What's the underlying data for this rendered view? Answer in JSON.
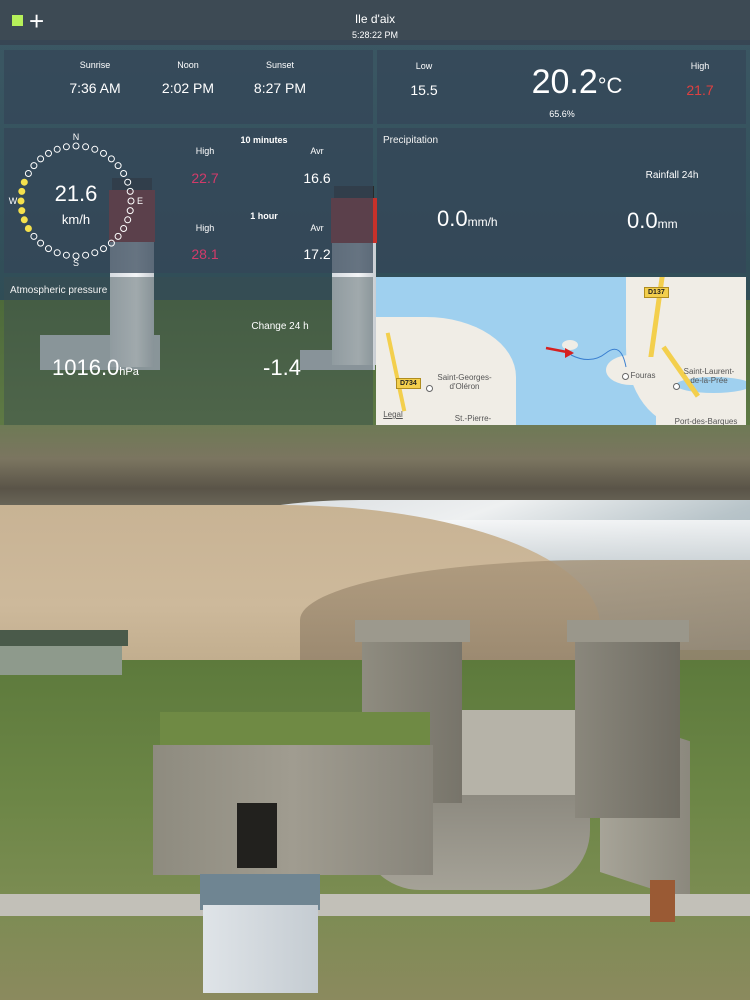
{
  "header": {
    "title": "Ile d'aix",
    "time": "5:28:22 PM",
    "add_symbol": "+",
    "status_color": "#b6f05a"
  },
  "sun": {
    "sunrise_label": "Sunrise",
    "sunrise": "7:36 AM",
    "noon_label": "Noon",
    "noon": "2:02 PM",
    "sunset_label": "Sunset",
    "sunset": "8:27 PM"
  },
  "temperature": {
    "low_label": "Low",
    "low": "15.5",
    "current": "20.2",
    "unit": "°C",
    "humidity": "65.6%",
    "high_label": "High",
    "high": "21.7"
  },
  "wind": {
    "speed": "21.6",
    "unit": "km/h",
    "compass": {
      "n": "N",
      "e": "E",
      "s": "S",
      "w": "W"
    },
    "ten_min": {
      "title": "10 minutes",
      "high_label": "High",
      "high": "22.7",
      "avg_label": "Avr",
      "avg": "16.6"
    },
    "one_hour": {
      "title": "1 hour",
      "high_label": "High",
      "high": "28.1",
      "avg_label": "Avr",
      "avg": "17.2"
    }
  },
  "precipitation": {
    "label": "Precipitation",
    "rate": "0.0",
    "rate_unit": "mm/h",
    "rainfall_label": "Rainfall 24h",
    "rainfall": "0.0",
    "rainfall_unit": "mm"
  },
  "pressure": {
    "label": "Atmospheric pressure",
    "value": "1016.0",
    "unit": "hPa",
    "change_label": "Change 24 h",
    "change": "-1.4"
  },
  "map": {
    "road_d137": "D137",
    "road_d734": "D734",
    "place_saint_georges": "Saint-Georges-\nd'Oléron",
    "place_fouras": "Fouras",
    "place_saint_laurent": "Saint-Laurent-\nde-la-Prée",
    "place_saint_pierre": "St.-Pierre-",
    "place_port_des_barques": "Port-des-Barques",
    "legal": "Legal"
  }
}
